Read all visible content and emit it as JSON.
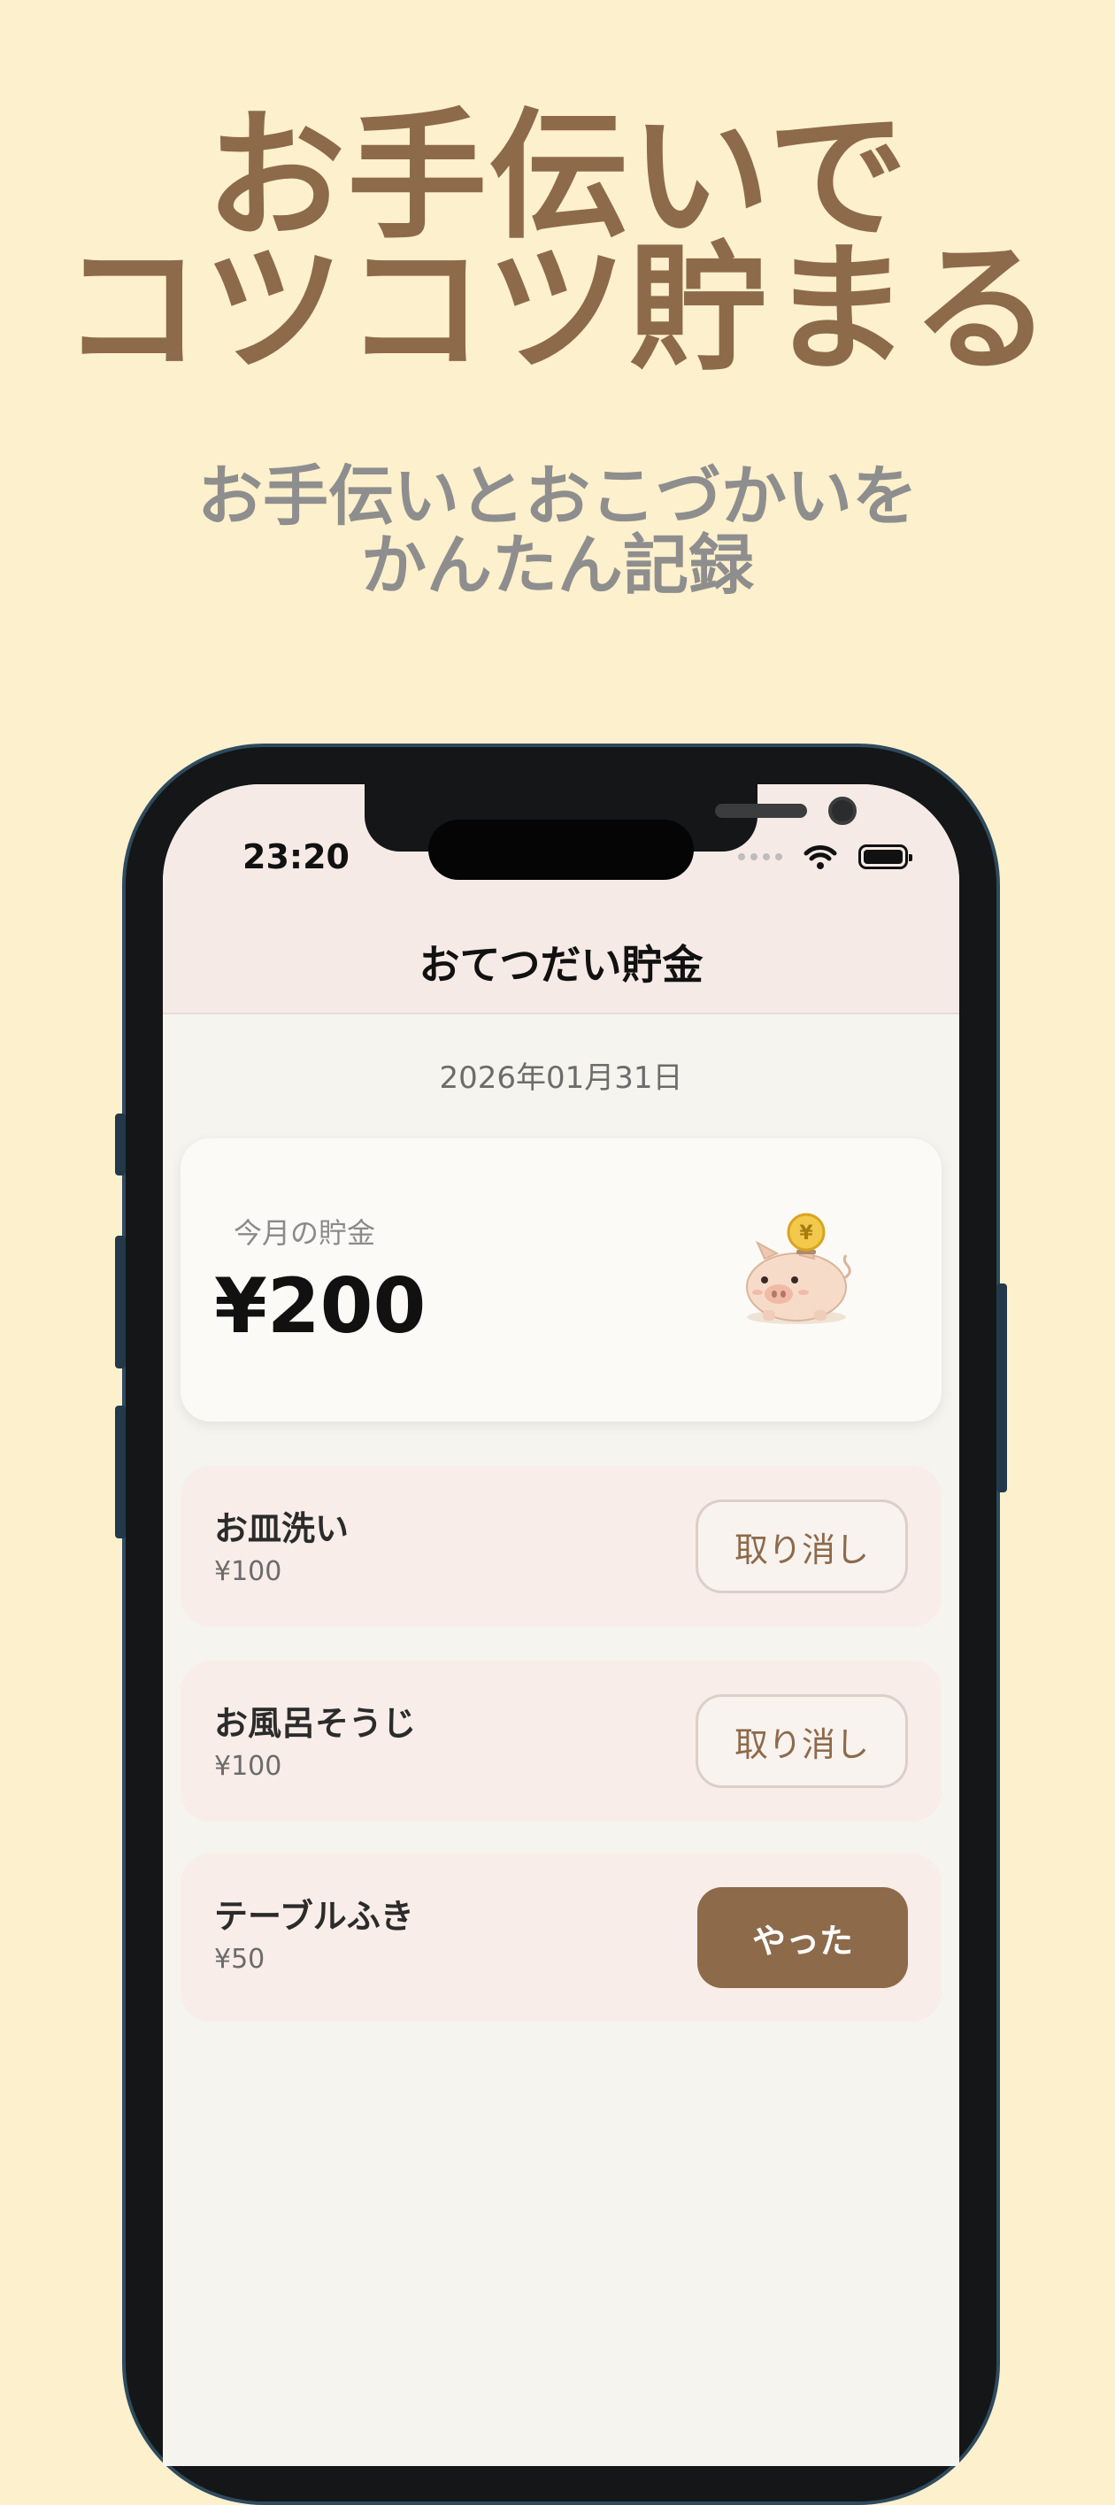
{
  "colors": {
    "background": "#FDF0CC",
    "accent": "#8D6A4A",
    "subtitle": "#8E8E8E"
  },
  "headline": {
    "line1": "お手伝いで",
    "line2": "コツコツ貯まる"
  },
  "subhead": {
    "line1": "お手伝いとおこづかいを",
    "line2": "かんたん記録"
  },
  "status_bar": {
    "time": "23:20",
    "icons": [
      "signal-dots-icon",
      "wifi-icon",
      "battery-icon"
    ]
  },
  "nav": {
    "title": "おてつだい貯金"
  },
  "date": "2026年01月31日",
  "savings": {
    "label": "今月の貯金",
    "amount": "¥200",
    "icon": "piggy-bank-coin-icon"
  },
  "tasks": [
    {
      "name": "お皿洗い",
      "reward": "¥100",
      "action": "取り消し",
      "done": true
    },
    {
      "name": "お風呂そうじ",
      "reward": "¥100",
      "action": "取り消し",
      "done": true
    },
    {
      "name": "テーブルふき",
      "reward": "¥50",
      "action": "やった",
      "done": false
    }
  ]
}
